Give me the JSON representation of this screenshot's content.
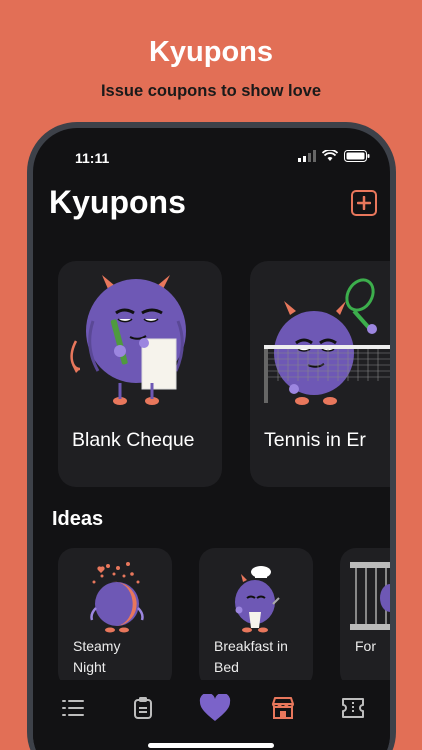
{
  "promo": {
    "title": "Kyupons",
    "subtitle": "Issue coupons to show love"
  },
  "status_bar": {
    "time": "11:11"
  },
  "header": {
    "title": "Kyupons"
  },
  "featured": [
    {
      "label": "Blank Cheque"
    },
    {
      "label": "Tennis in Er"
    }
  ],
  "ideas": {
    "title": "Ideas",
    "items": [
      {
        "label": "Steamy\nNight"
      },
      {
        "label": "Breakfast in\nBed"
      },
      {
        "label": "For"
      }
    ]
  },
  "colors": {
    "accent": "#E8775C",
    "background": "#E26F56",
    "screen": "#121214",
    "card": "#1f1f22",
    "monster": "#6E58B5",
    "heart": "#7B63C9"
  },
  "tabbar": {
    "items": [
      "list-icon",
      "clipboard-icon",
      "heart-icon",
      "store-icon",
      "ticket-icon"
    ],
    "selected": "store-icon"
  }
}
